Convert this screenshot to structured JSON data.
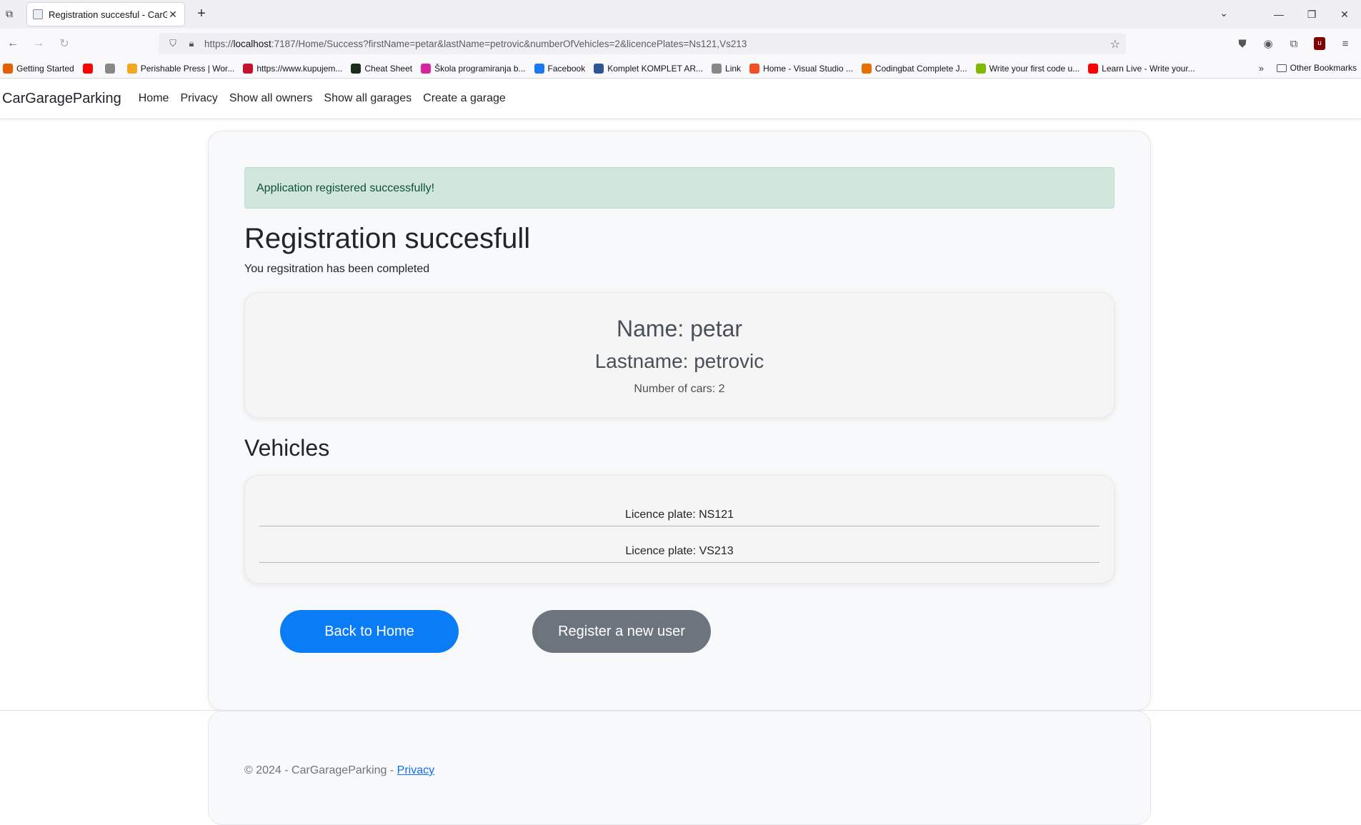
{
  "browser": {
    "tab_title": "Registration succesful - CarGar",
    "url_prefix": "https://",
    "url_host": "localhost",
    "url_rest": ":7187/Home/Success?firstName=petar&lastName=petrovic&numberOfVehicles=2&licencePlates=Ns121,Vs213",
    "bookmarks": [
      {
        "label": "Getting Started",
        "color": "#e66000"
      },
      {
        "label": "",
        "color": "#ff0000"
      },
      {
        "label": "",
        "color": "#888888"
      },
      {
        "label": "Perishable Press | Wor...",
        "color": "#f5a623"
      },
      {
        "label": "https://www.kupujem...",
        "color": "#c8102e"
      },
      {
        "label": "Cheat Sheet",
        "color": "#1d2b1d"
      },
      {
        "label": "Škola programiranja b...",
        "color": "#d6249f"
      },
      {
        "label": "Facebook",
        "color": "#1877f2"
      },
      {
        "label": "Komplet KOMPLET AR...",
        "color": "#2b5797"
      },
      {
        "label": "Link",
        "color": "#888888"
      },
      {
        "label": "Home - Visual Studio ...",
        "color": "#f25022"
      },
      {
        "label": "Codingbat Complete J...",
        "color": "#e76f00"
      },
      {
        "label": "Write your first code u...",
        "color": "#7fba00"
      },
      {
        "label": "Learn Live - Write your...",
        "color": "#ff0000"
      }
    ],
    "other_bookmarks": "Other Bookmarks"
  },
  "site": {
    "brand": "CarGarageParking",
    "nav": [
      "Home",
      "Privacy",
      "Show all owners",
      "Show all garages",
      "Create a garage"
    ]
  },
  "main": {
    "alert": "Application registered successfully!",
    "title": "Registration succesfull",
    "subtitle": "You regsitration has been completed",
    "name": "Name: petar",
    "lastname": "Lastname: petrovic",
    "cars": "Number of cars: 2",
    "vehicles_heading": "Vehicles",
    "vehicles": [
      "Licence plate: NS121",
      "Licence plate: VS213"
    ],
    "btn_home": "Back to Home",
    "btn_register": "Register a new user"
  },
  "footer": {
    "text": "© 2024 - CarGarageParking - ",
    "privacy": "Privacy"
  }
}
